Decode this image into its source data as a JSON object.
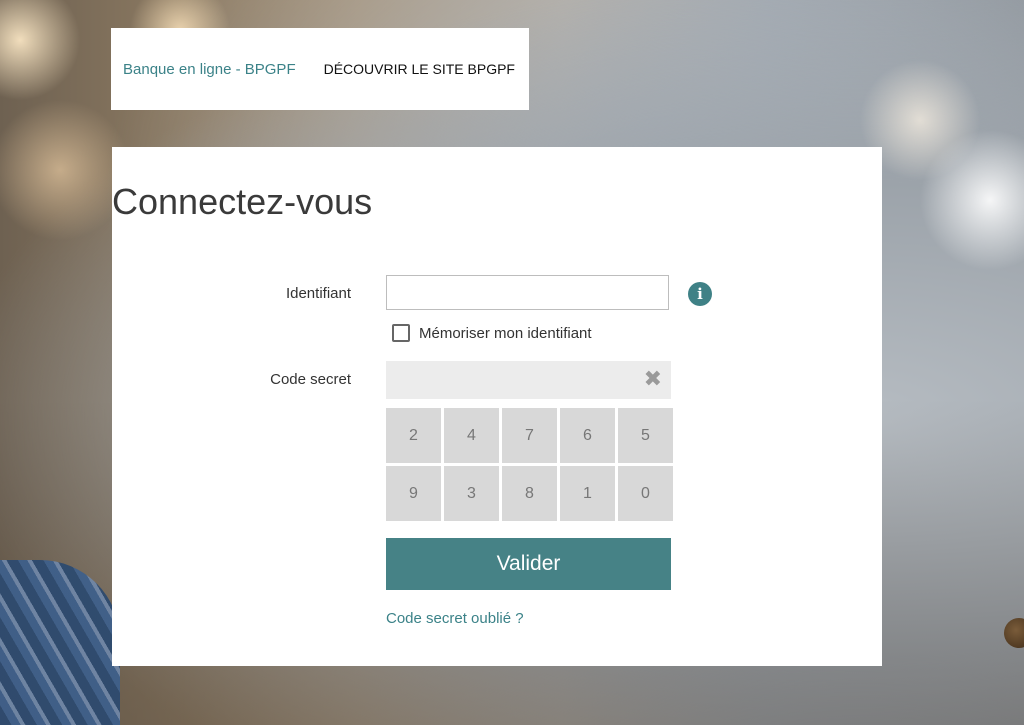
{
  "header": {
    "brand_link": "Banque en ligne - BPGPF",
    "discover_link": "DÉCOUVRIR LE SITE BPGPF"
  },
  "login": {
    "title": "Connectez-vous",
    "identifier_label": "Identifiant",
    "identifier_value": "",
    "info_glyph": "i",
    "remember_label": "Mémoriser mon identifiant",
    "remember_checked": false,
    "secret_code_label": "Code secret",
    "secret_code_value": "",
    "clear_glyph": "✖",
    "keypad": [
      "2",
      "4",
      "7",
      "6",
      "5",
      "9",
      "3",
      "8",
      "1",
      "0"
    ],
    "submit_label": "Valider",
    "forgot_link": "Code secret oublié ?"
  },
  "colors": {
    "accent": "#468286",
    "link": "#3b8288",
    "key_bg": "#d8d8d8"
  },
  "icons": {
    "info": "info-icon",
    "clear": "clear-icon",
    "checkbox": "checkbox-icon"
  }
}
